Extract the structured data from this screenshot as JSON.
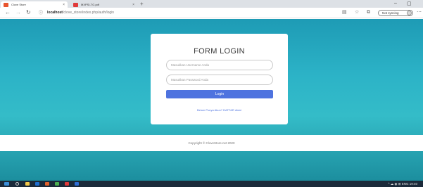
{
  "browser": {
    "tabs": [
      {
        "title": "Clove Store",
        "active": true,
        "favicon_color": "#e8542e"
      },
      {
        "title": "MXPSI-TG.pdf",
        "active": false,
        "favicon_color": "#e03a3a"
      }
    ],
    "new_tab_symbol": "+",
    "close_symbol": "×",
    "minimize_symbol": "–",
    "maximize_symbol": "▢",
    "url_host": "localhost",
    "url_path": "/clove_store/index.php/auth/login",
    "sync_label": "Not syncing"
  },
  "page": {
    "form_title": "FORM LOGIN",
    "username_placeholder": "Masukkan Username Anda",
    "password_placeholder": "Masukkan Password Anda",
    "login_label": "Login",
    "register_link": "Belum Punya Akun? DAFTAR disini",
    "footer_text": "Copyright © CloveStore.net 2020",
    "accent_color": "#4e73df"
  },
  "taskbar": {
    "app_colors": [
      "#3b8fd9",
      "#f2c84b",
      "#1f6fd1",
      "#e0622c",
      "#4caf50",
      "#e03a3a",
      "#2f6fd6"
    ],
    "tray_text": "^  ☁  ◉  ⊞  ENG  19:40"
  }
}
